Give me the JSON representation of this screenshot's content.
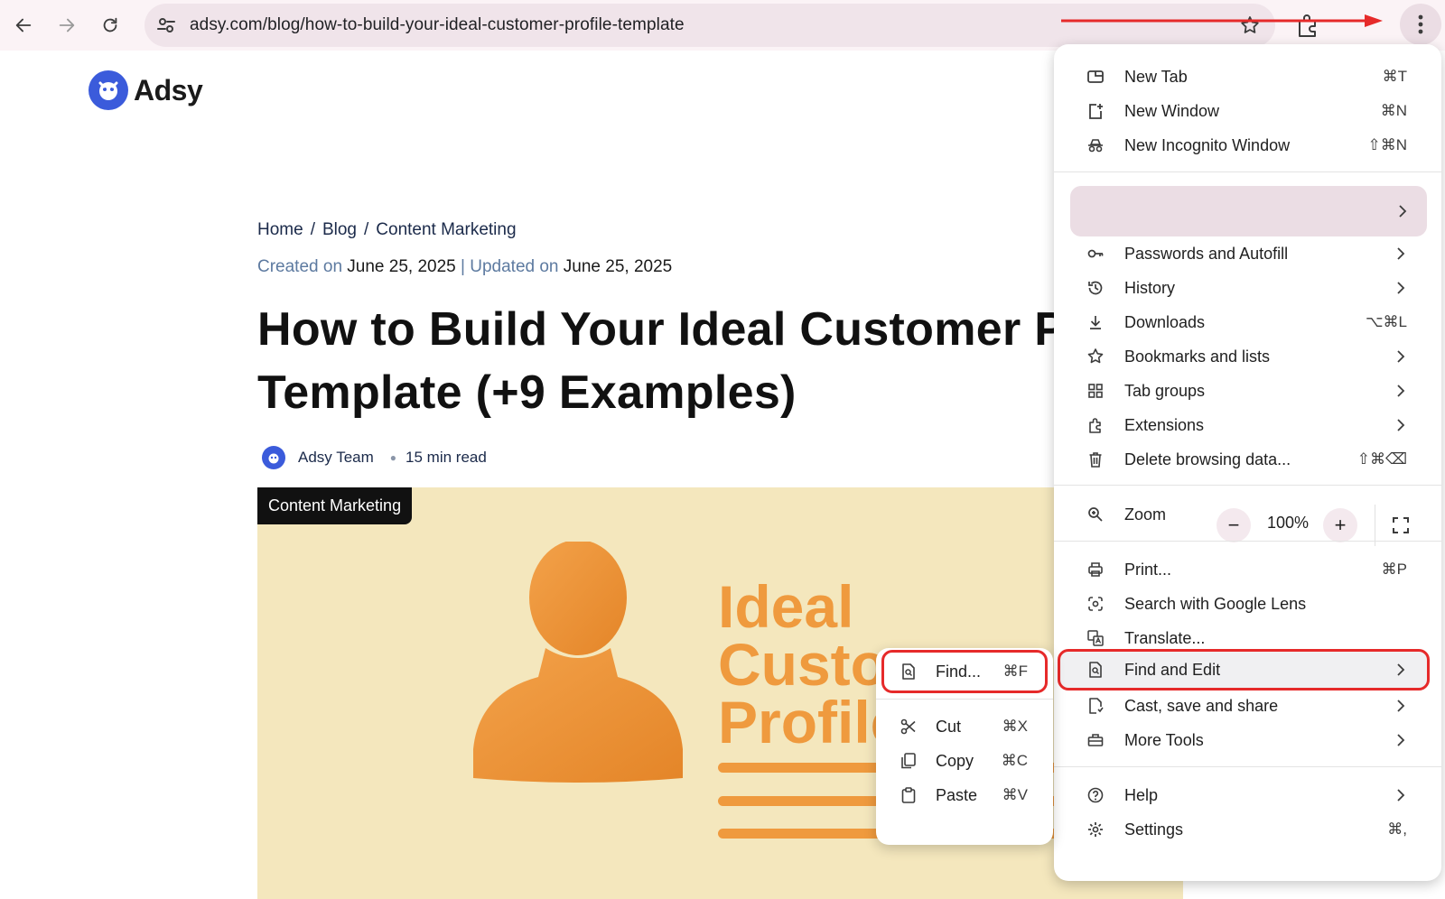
{
  "browser": {
    "url": "adsy.com/blog/how-to-build-your-ideal-customer-profile-template",
    "menu_button_label": "⋮"
  },
  "page": {
    "logo_text": "Adsy",
    "breadcrumb": [
      "Home",
      "Blog",
      "Content Marketing"
    ],
    "breadcrumb_separator": "/",
    "created_label": "Created on",
    "created_date": "June 25, 2025",
    "date_divider": "|",
    "updated_label": "Updated on",
    "updated_date": "June 25, 2025",
    "title_line1": "How to Build Your Ideal Customer Profile",
    "title_line2": "Template (+9 Examples)",
    "author": "Adsy Team",
    "read_time": "15 min read",
    "tag": "Content Marketing",
    "hero_text": [
      "Ideal",
      "Customer",
      "Profile"
    ]
  },
  "menu": {
    "new_tab": {
      "label": "New Tab",
      "shortcut": "⌘T"
    },
    "new_window": {
      "label": "New Window",
      "shortcut": "⌘N"
    },
    "new_incognito": {
      "label": "New Incognito Window",
      "shortcut": "⇧⌘N"
    },
    "passwords": {
      "label": "Passwords and Autofill"
    },
    "history": {
      "label": "History"
    },
    "downloads": {
      "label": "Downloads",
      "shortcut": "⌥⌘L"
    },
    "bookmarks": {
      "label": "Bookmarks and lists"
    },
    "tab_groups": {
      "label": "Tab groups"
    },
    "extensions": {
      "label": "Extensions"
    },
    "delete_data": {
      "label": "Delete browsing data...",
      "shortcut": "⇧⌘⌫"
    },
    "zoom": {
      "label": "Zoom",
      "minus": "−",
      "value": "100%",
      "plus": "+"
    },
    "print": {
      "label": "Print...",
      "shortcut": "⌘P"
    },
    "lens": {
      "label": "Search with Google Lens"
    },
    "translate": {
      "label": "Translate..."
    },
    "find_edit": {
      "label": "Find and Edit"
    },
    "cast": {
      "label": "Cast, save and share"
    },
    "more_tools": {
      "label": "More Tools"
    },
    "help": {
      "label": "Help"
    },
    "settings": {
      "label": "Settings",
      "shortcut": "⌘,"
    }
  },
  "submenu": {
    "find": {
      "label": "Find...",
      "shortcut": "⌘F"
    },
    "cut": {
      "label": "Cut",
      "shortcut": "⌘X"
    },
    "copy": {
      "label": "Copy",
      "shortcut": "⌘C"
    },
    "paste": {
      "label": "Paste",
      "shortcut": "⌘V"
    }
  },
  "colors": {
    "accent_red": "#e62a2a",
    "brand_blue": "#3b5bdb",
    "hero_orange": "#ef9a3e",
    "hero_bg": "#f4e7bd"
  }
}
